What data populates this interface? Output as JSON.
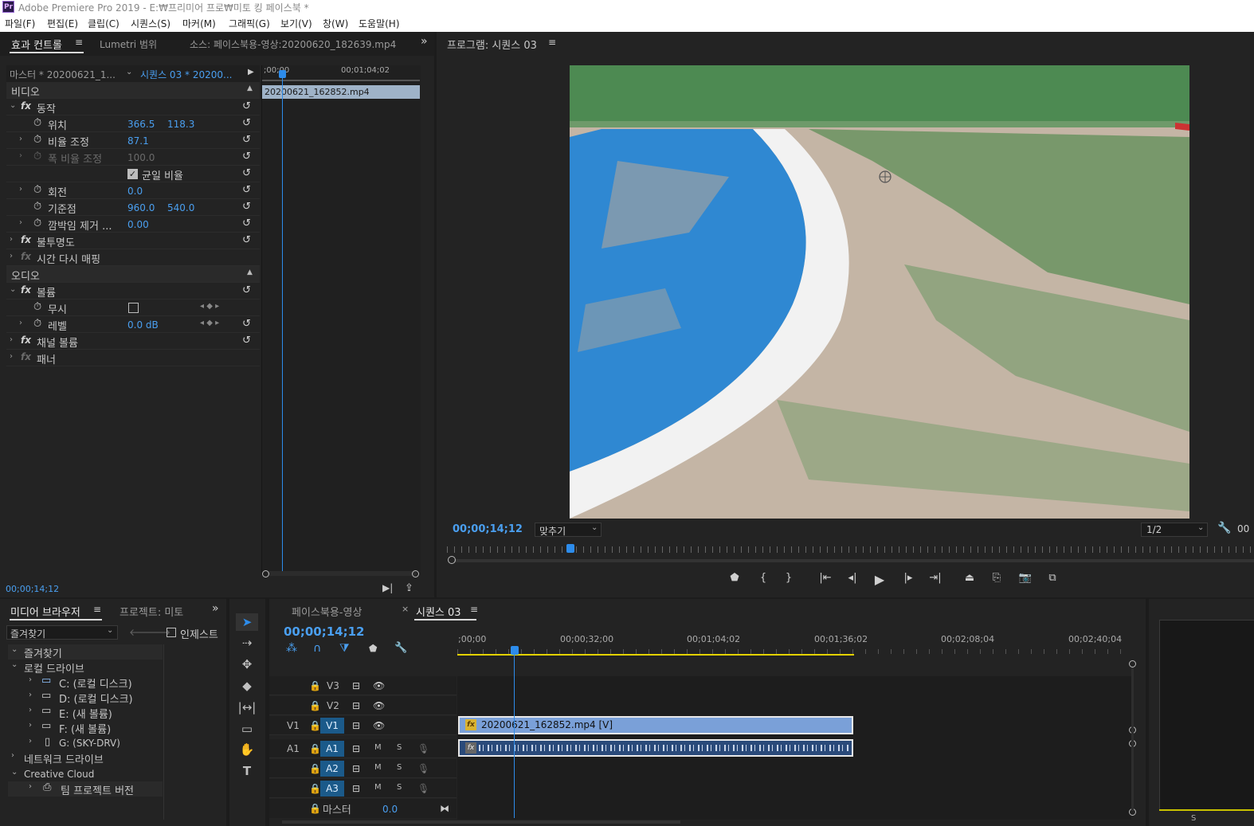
{
  "window": {
    "app_icon": "Pr",
    "title": "Adobe Premiere Pro 2019 - E:₩프리미어 프로₩미토 킹 페이스북 *"
  },
  "menu": [
    "파일(F)",
    "편집(E)",
    "클립(C)",
    "시퀀스(S)",
    "마커(M)",
    "그래픽(G)",
    "보기(V)",
    "창(W)",
    "도움말(H)"
  ],
  "effect_panel": {
    "tabs": [
      "효과 컨트롤",
      "Lumetri 범위",
      "소스: 페이스북용-영상:20200620_182639.mp4"
    ],
    "master": "마스터 * 20200621_1...",
    "sequence": "시퀀스 03 * 20200...",
    "timecode_start": ";00;00",
    "timecode_end": "00;01;04;02",
    "clip_name": "20200621_162852.mp4",
    "section_video": "비디오",
    "section_audio": "오디오",
    "rows": {
      "motion": "동작",
      "position": "위치",
      "position_x": "366.5",
      "position_y": "118.3",
      "scale": "비율 조정",
      "scale_val": "87.1",
      "scale_width": "폭 비율 조정",
      "scale_width_val": "100.0",
      "uniform": "균일 비율",
      "rotation": "회전",
      "rotation_val": "0.0",
      "anchor": "기준점",
      "anchor_x": "960.0",
      "anchor_y": "540.0",
      "flicker": "깜박임 제거 ...",
      "flicker_val": "0.00",
      "opacity": "불투명도",
      "time_remap": "시간 다시 매핑",
      "volume": "볼륨",
      "bypass": "무시",
      "level": "레벨",
      "level_val": "0.0 dB",
      "channel_volume": "채널 볼륨",
      "panner": "패너"
    },
    "footer_timecode": "00;00;14;12"
  },
  "program": {
    "title": "프로그램: 시퀀스 03",
    "timecode": "00;00;14;12",
    "fit": "맞추기",
    "resolution": "1/2",
    "extra": "00"
  },
  "browser": {
    "tabs": [
      "미디어 브라우저",
      "프로젝트: 미토"
    ],
    "favorites_select": "즐겨찾기",
    "ingest": "인제스트",
    "tree": {
      "favorites": "즐겨찾기",
      "local": "로컬 드라이브",
      "drives": [
        "C: (로컬 디스크)",
        "D: (로컬 디스크)",
        "E: (새 볼륨)",
        "F: (새 볼륨)",
        "G: (SKY-DRV)"
      ],
      "network": "네트워크 드라이브",
      "cloud": "Creative Cloud",
      "team": "팀 프로젝트 버전"
    }
  },
  "timeline": {
    "tabs": [
      "페이스북용-영상",
      "시퀀스 03"
    ],
    "timecode": "00;00;14;12",
    "ruler": [
      ";00;00",
      "00;00;32;00",
      "00;01;04;02",
      "00;01;36;02",
      "00;02;08;04",
      "00;02;40;04"
    ],
    "tracks": {
      "v3": "V3",
      "v2": "V2",
      "v1_src": "V1",
      "v1": "V1",
      "a1_src": "A1",
      "a1": "A1",
      "a2": "A2",
      "a3": "A3",
      "m": "M",
      "s": "S",
      "master": "마스터",
      "master_val": "0.0"
    },
    "clip_video": "20200621_162852.mp4 [V]",
    "clip_fx": "fx"
  },
  "colors": {
    "accent": "#2d8ceb",
    "clip_video": "#7aa0d8",
    "clip_audio": "#2a4a7a",
    "work_area": "#e3d200"
  }
}
